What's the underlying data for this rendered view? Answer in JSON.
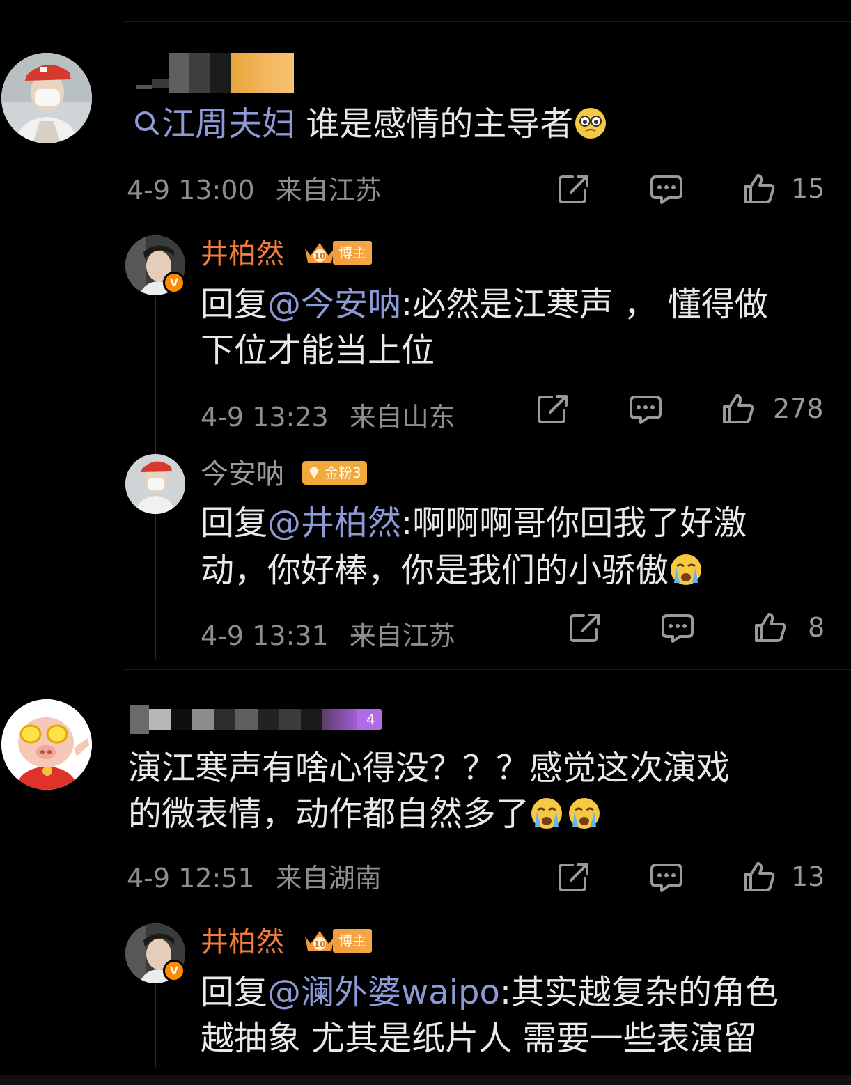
{
  "comments": [
    {
      "search_keyword": "江周夫妇",
      "text": " 谁是感情的主导者",
      "time": "4-9 13:00",
      "location": "来自江苏",
      "likes": "15",
      "replies": [
        {
          "user": "井柏然",
          "badge": "博主",
          "reply_prefix": "回复",
          "mention": "@今安呐",
          "text_line1": ":必然是江寒声 ， 懂得做",
          "text_line2": "下位才能当上位",
          "time": "4-9 13:23",
          "location": "来自山东",
          "likes": "278"
        },
        {
          "user": "今安呐",
          "badge": "金粉3",
          "reply_prefix": "回复",
          "mention": "@井柏然",
          "text_line1": ":啊啊啊哥你回我了好激",
          "text_line2": "动，你好棒，你是我们的小骄傲",
          "time": "4-9 13:31",
          "location": "来自江苏",
          "likes": "8"
        }
      ]
    },
    {
      "badge_partial": "4",
      "text_line1": "演江寒声有啥心得没？？？感觉这次演戏",
      "text_line2": "的微表情，动作都自然多了",
      "time": "4-9 12:51",
      "location": "来自湖南",
      "likes": "13",
      "replies": [
        {
          "user": "井柏然",
          "badge": "博主",
          "reply_prefix": "回复",
          "mention": "@澜外婆waipo",
          "text_line1": ":其实越复杂的角色",
          "text_line2": "越抽象 尤其是纸片人 需要一些表演留"
        }
      ]
    }
  ],
  "icons": {
    "share": "share-icon",
    "comment": "comment-icon",
    "like": "thumbs-up-icon",
    "search": "search-icon",
    "verified": "verified-v-icon",
    "crown": "crown-badge-icon"
  },
  "verified_mark": "V",
  "host_level": "10",
  "colors": {
    "background": "#000000",
    "mention": "#8d9ad6",
    "host_name": "#f07d3a",
    "meta": "#8e8e8e"
  }
}
